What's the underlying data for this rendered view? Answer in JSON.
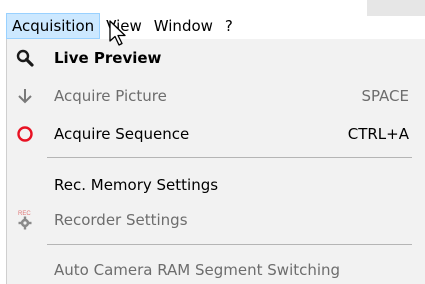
{
  "menubar": {
    "items": [
      {
        "label": "Acquisition"
      },
      {
        "label": "View"
      },
      {
        "label": "Window"
      },
      {
        "label": "?"
      }
    ]
  },
  "menu": {
    "items": [
      {
        "label": "Live Preview",
        "shortcut": "",
        "enabled": true,
        "icon": "magnifier-icon"
      },
      {
        "label": "Acquire Picture",
        "shortcut": "SPACE",
        "enabled": false,
        "icon": "down-arrow-icon"
      },
      {
        "label": "Acquire Sequence",
        "shortcut": "CTRL+A",
        "enabled": true,
        "icon": "record-circle-icon"
      },
      {
        "label": "Rec. Memory Settings",
        "shortcut": "",
        "enabled": true,
        "icon": ""
      },
      {
        "label": "Recorder Settings",
        "shortcut": "",
        "enabled": false,
        "icon": "rec-gear-icon"
      },
      {
        "label": "Auto Camera RAM Segment Switching",
        "shortcut": "",
        "enabled": false,
        "icon": ""
      }
    ]
  },
  "colors": {
    "menubar_highlight": "#cce8ff",
    "menu_background": "#f2f2f2",
    "record_red": "#e81123",
    "disabled_text": "#6d6d6d"
  }
}
